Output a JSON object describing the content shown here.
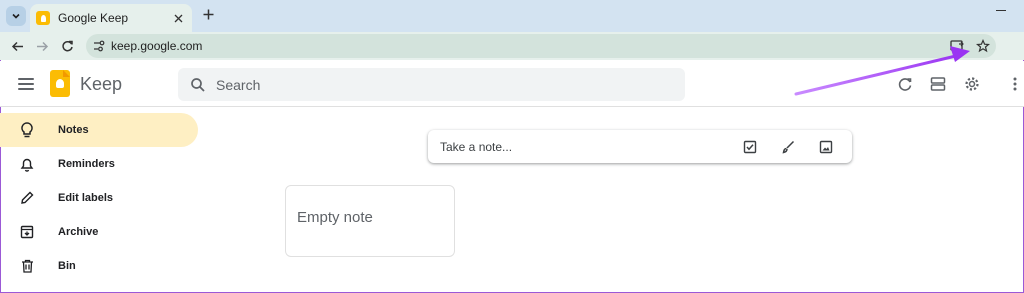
{
  "browser": {
    "tab_title": "Google Keep",
    "url": "keep.google.com"
  },
  "header": {
    "app_name": "Keep",
    "search_placeholder": "Search"
  },
  "sidebar": {
    "items": [
      {
        "label": "Notes",
        "icon": "lightbulb-icon",
        "active": true
      },
      {
        "label": "Reminders",
        "icon": "bell-icon",
        "active": false
      },
      {
        "label": "Edit labels",
        "icon": "pencil-icon",
        "active": false
      },
      {
        "label": "Archive",
        "icon": "archive-icon",
        "active": false
      },
      {
        "label": "Bin",
        "icon": "trash-icon",
        "active": false
      }
    ]
  },
  "main": {
    "take_note_placeholder": "Take a note...",
    "note_card_title": "Empty note"
  },
  "colors": {
    "accent_active": "#feefc3",
    "keep_yellow": "#fbbc04",
    "annotation_arrow": "#a040f0"
  }
}
